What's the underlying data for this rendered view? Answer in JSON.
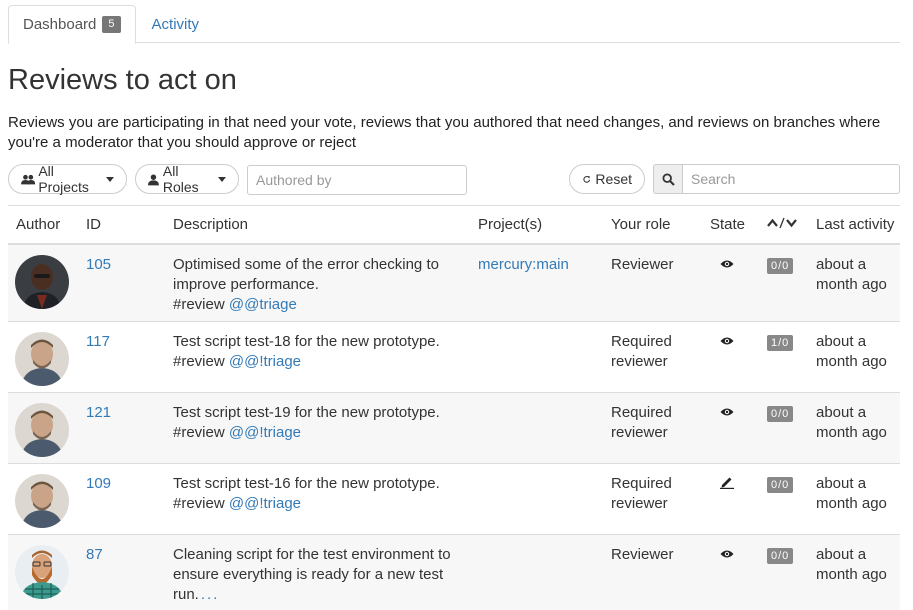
{
  "tabs": [
    {
      "label": "Dashboard",
      "badge": "5"
    },
    {
      "label": "Activity"
    }
  ],
  "heading": "Reviews to act on",
  "intro": "Reviews you are participating in that need your vote, reviews that you authored that need changes, and reviews on branches where you're a moderator that you should approve or reject",
  "filters": {
    "projects_label": "All Projects",
    "roles_label": "All Roles",
    "authored_placeholder": "Authored by",
    "reset_label": "Reset",
    "search_placeholder": "Search"
  },
  "columns": {
    "author": "Author",
    "id": "ID",
    "description": "Description",
    "projects": "Project(s)",
    "role": "Your role",
    "state": "State",
    "last_activity": "Last activity"
  },
  "rows": [
    {
      "id": "105",
      "desc_line1": "Optimised some of the error checking to",
      "desc_line2": "improve performance.",
      "desc_tag": "#review",
      "desc_mention": "@@triage",
      "project": "mercury:main",
      "role_line1": "Reviewer",
      "role_line2": "",
      "state_icon": "eye-icon",
      "votes": "0/0",
      "activity_line1": "about a",
      "activity_line2": "month ago"
    },
    {
      "id": "117",
      "desc_line1": "Test script test-18 for the new prototype.",
      "desc_line2": "",
      "desc_tag": "#review",
      "desc_mention": "@@!triage",
      "project": "",
      "role_line1": "Required",
      "role_line2": "reviewer",
      "state_icon": "eye-icon",
      "votes": "1/0",
      "activity_line1": "about a",
      "activity_line2": "month ago"
    },
    {
      "id": "121",
      "desc_line1": "Test script test-19 for the new prototype.",
      "desc_line2": "",
      "desc_tag": "#review",
      "desc_mention": "@@!triage",
      "project": "",
      "role_line1": "Required",
      "role_line2": "reviewer",
      "state_icon": "eye-icon",
      "votes": "0/0",
      "activity_line1": "about a",
      "activity_line2": "month ago"
    },
    {
      "id": "109",
      "desc_line1": "Test script test-16 for the new prototype.",
      "desc_line2": "",
      "desc_tag": "#review",
      "desc_mention": "@@!triage",
      "project": "",
      "role_line1": "Required",
      "role_line2": "reviewer",
      "state_icon": "pencil-icon",
      "votes": "0/0",
      "activity_line1": "about a",
      "activity_line2": "month ago"
    },
    {
      "id": "87",
      "desc_line1": "Cleaning script for the test environment to",
      "desc_line2": "ensure everything is ready for a new test",
      "desc_line3": "run.",
      "desc_more": "...",
      "project": "",
      "role_line1": "Reviewer",
      "role_line2": "",
      "state_icon": "eye-icon",
      "votes": "0/0",
      "activity_line1": "about a",
      "activity_line2": "month ago"
    }
  ]
}
